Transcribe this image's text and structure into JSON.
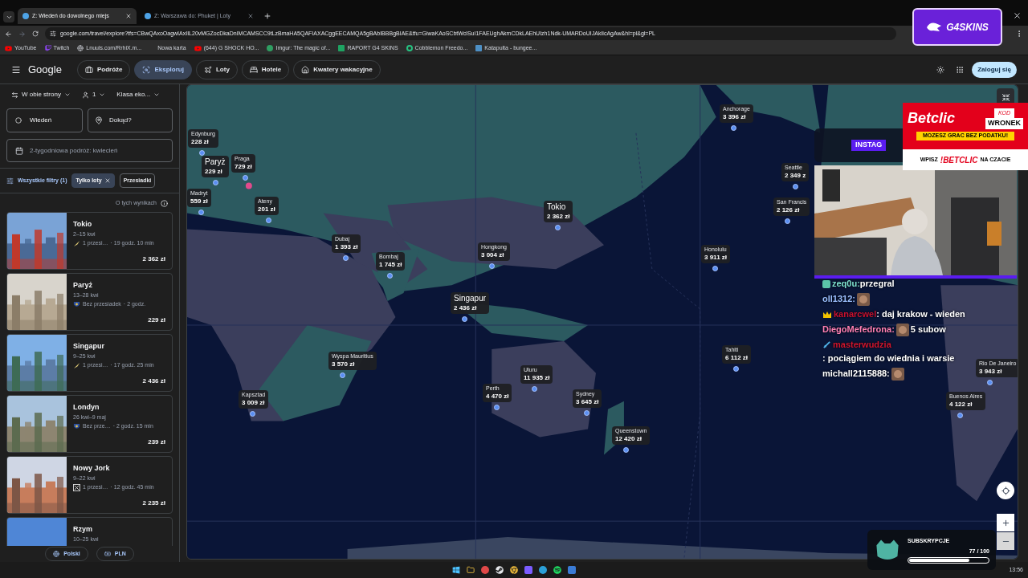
{
  "browser": {
    "tabs": [
      {
        "title": "Z: Wiedeń do dowolnego miejs",
        "selected": true
      },
      {
        "title": "Z: Warszawa do: Phuket | Loty",
        "selected": false
      }
    ],
    "url": "google.com/travel/explore?tfs=CBwQAxoOagwIAxIIL20vMGZocDkaDnIMCAMSCC9tLzBmaHA5QAFIAXACggEECAMQA5gBAbIBBBgBIAE&tfu=GiwaKAoSCbtWclSuI1FAEUghAkmCDkLAEhUIzh1Ndk-UMARDoUIJAkIicAgAw&hl=pl&gl=PL",
    "bookmarks": [
      {
        "label": "YouTube",
        "kind": "youtube"
      },
      {
        "label": "Twitch",
        "kind": "twitch"
      },
      {
        "label": "Lnuuls.com/RrhiX.m...",
        "kind": "globe"
      },
      {
        "label": "Nowa karta",
        "kind": "none"
      },
      {
        "label": "(644) G SHOCK HO...",
        "kind": "youtube"
      },
      {
        "label": "Imgur: The magic of...",
        "kind": "imgur"
      },
      {
        "label": "RAPORT G4 SKINS",
        "kind": "sheet"
      },
      {
        "label": "Cobblemon Freedo...",
        "kind": "cobble"
      },
      {
        "label": "Katapulta - bungee...",
        "kind": "page"
      }
    ]
  },
  "header": {
    "brand": "Google",
    "nav": [
      {
        "label": "Podróże",
        "kind": "trips",
        "selected": false
      },
      {
        "label": "Eksploruj",
        "kind": "explore",
        "selected": true
      },
      {
        "label": "Loty",
        "kind": "flights",
        "selected": false
      },
      {
        "label": "Hotele",
        "kind": "hotels",
        "selected": false
      },
      {
        "label": "Kwatery wakacyjne",
        "kind": "rentals",
        "selected": false
      }
    ],
    "sign_in": "Zaloguj się"
  },
  "search": {
    "trip_type": "W obie strony",
    "passengers": "1",
    "cabin": "Klasa eko...",
    "origin": "Wiedeń",
    "destination_placeholder": "Dokąd?",
    "dates": "2-tygodniowa podróż: kwiecień"
  },
  "filters": {
    "all": "Wszystkie filtry (1)",
    "chips": [
      {
        "label": "Tylko loty",
        "selected": true
      },
      {
        "label": "Przesiadki",
        "selected": false
      }
    ]
  },
  "about": "O tych wynikach",
  "results": [
    {
      "city": "Tokio",
      "dates": "2–15 kwi",
      "airline": {
        "kind": "wing"
      },
      "stops": "1 przesi…",
      "duration": "· 19 godz. 10 min",
      "price": "2 362 zł"
    },
    {
      "city": "Paryż",
      "dates": "13–28 kwi",
      "airline": {
        "kind": "crest"
      },
      "stops": "Bez przesiadek",
      "duration": "· 2 godz.",
      "price": "229 zł"
    },
    {
      "city": "Singapur",
      "dates": "9–25 kwi",
      "airline": {
        "kind": "wing"
      },
      "stops": "1 przesi…",
      "duration": "· 17 godz. 25 min",
      "price": "2 436 zł"
    },
    {
      "city": "Londyn",
      "dates": "26 kwi–9 maj",
      "airline": {
        "kind": "crest"
      },
      "stops": "Bez prze…",
      "duration": "· 2 godz. 15 min",
      "price": "239 zł"
    },
    {
      "city": "Nowy Jork",
      "dates": "9–22 kwi",
      "airline": {
        "kind": "multi"
      },
      "stops": "1 przesi…",
      "duration": "· 12 godz. 45 min",
      "price": "2 235 zł"
    },
    {
      "city": "Rzym",
      "dates": "10–25 kwi"
    }
  ],
  "footer": {
    "language": "Polski",
    "currency": "PLN"
  },
  "map": {
    "pins": [
      {
        "city": "Edynburg",
        "price": "228 zł",
        "kind": "small"
      },
      {
        "city": "Paryż",
        "price": "229 zł",
        "kind": "large"
      },
      {
        "city": "Praga",
        "price": "729 zł",
        "kind": "small"
      },
      {
        "city": "Madryt",
        "price": "559 zł",
        "kind": "small"
      },
      {
        "city": "Ateny",
        "price": "201 zł",
        "kind": "small"
      },
      {
        "city": "Dubaj",
        "price": "1 393 zł",
        "kind": "small"
      },
      {
        "city": "Bombaj",
        "price": "1 745 zł",
        "kind": "small"
      },
      {
        "city": "Hongkong",
        "price": "3 004 zł",
        "kind": "small"
      },
      {
        "city": "Singapur",
        "price": "2 436 zł",
        "kind": "large"
      },
      {
        "city": "Tokio",
        "price": "2 362 zł",
        "kind": "large"
      },
      {
        "city": "Anchorage",
        "price": "3 396 zł",
        "kind": "small"
      },
      {
        "city": "Seattle",
        "price": "2 349 z",
        "kind": "small"
      },
      {
        "city": "San Francis",
        "price": "2 126 zł",
        "kind": "small"
      },
      {
        "city": "Honolulu",
        "price": "3 911 zł",
        "kind": "small"
      },
      {
        "city": "Tahiti",
        "price": "6 112 zł",
        "kind": "small"
      },
      {
        "city": "Wyspa Mauritius",
        "price": "3 570 zł",
        "kind": "small"
      },
      {
        "city": "Kapsztad",
        "price": "3 009 zł",
        "kind": "small"
      },
      {
        "city": "Uluru",
        "price": "11 935 zł",
        "kind": "small"
      },
      {
        "city": "Perth",
        "price": "4 470 zł",
        "kind": "small"
      },
      {
        "city": "Sydney",
        "price": "3 645 zł",
        "kind": "small"
      },
      {
        "city": "Queenstown",
        "price": "12 420 zł",
        "kind": "small"
      },
      {
        "city": "Rio De Janeiro",
        "price": "3 943 zł",
        "kind": "small"
      },
      {
        "city": "Buenos Aires",
        "price": "4 122 zł",
        "kind": "small"
      }
    ]
  },
  "stream": {
    "logo": "G4SKINS",
    "social_label": "INSTAG",
    "ad": {
      "brand": "Betclic",
      "code_label": "KOD",
      "code": "WRONEK",
      "slogan": "MOZESZ GRAC BEZ PODATKU!",
      "cta_before": "WPISZ",
      "cta_command": "!BETCLIC",
      "cta_after": "NA CZACIE"
    },
    "chat": [
      {
        "badge": {
          "kind": "sub"
        },
        "user": "zeq0u:",
        "color": "#7fe3d0",
        "emote": false,
        "text": "przegral"
      },
      {
        "user": "oll1312:",
        "color": "#9cc0ff",
        "emote": true
      },
      {
        "badge": {
          "kind": "crown"
        },
        "user": "kanarcwel",
        "color": "#c8102e",
        "emote": false,
        "text": ": daj krakow - wieden"
      },
      {
        "user": "DiegoMefedrona:",
        "color": "#ff80b4",
        "emote": true,
        "text": "5 subow"
      },
      {
        "badge": {
          "kind": "sword"
        },
        "user": "masterwudzia",
        "color": "#d0142c",
        "emote": false,
        "text": ": pociągiem do wiednia i warsie"
      },
      {
        "user": "michall2115888:",
        "color": "#ffffff",
        "emote": true
      }
    ],
    "subs": {
      "label": "SUBSKRYPCJE",
      "count": "77 / 100",
      "level": 0.77
    }
  },
  "taskbar": {
    "time": "13:56"
  }
}
